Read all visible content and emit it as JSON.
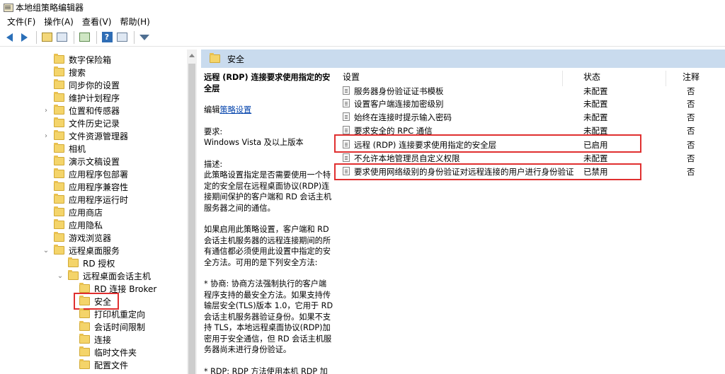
{
  "window": {
    "title": "本地组策略编辑器"
  },
  "menu": [
    "文件(F)",
    "操作(A)",
    "查看(V)",
    "帮助(H)"
  ],
  "toolbar": {
    "icons": [
      "back-icon",
      "forward-icon",
      "up-folder-icon",
      "show-hide-tree-icon",
      "export-icon",
      "help-icon",
      "properties-icon",
      "filter-icon"
    ],
    "help_glyph": "?"
  },
  "tree": {
    "items": [
      {
        "label": "数字保险箱",
        "indent": 0,
        "expander": ""
      },
      {
        "label": "搜索",
        "indent": 0,
        "expander": ""
      },
      {
        "label": "同步你的设置",
        "indent": 0,
        "expander": ""
      },
      {
        "label": "维护计划程序",
        "indent": 0,
        "expander": ""
      },
      {
        "label": "位置和传感器",
        "indent": 0,
        "expander": "›"
      },
      {
        "label": "文件历史记录",
        "indent": 0,
        "expander": ""
      },
      {
        "label": "文件资源管理器",
        "indent": 0,
        "expander": "›"
      },
      {
        "label": "相机",
        "indent": 0,
        "expander": ""
      },
      {
        "label": "演示文稿设置",
        "indent": 0,
        "expander": ""
      },
      {
        "label": "应用程序包部署",
        "indent": 0,
        "expander": ""
      },
      {
        "label": "应用程序兼容性",
        "indent": 0,
        "expander": ""
      },
      {
        "label": "应用程序运行时",
        "indent": 0,
        "expander": ""
      },
      {
        "label": "应用商店",
        "indent": 0,
        "expander": ""
      },
      {
        "label": "应用隐私",
        "indent": 0,
        "expander": ""
      },
      {
        "label": "游戏浏览器",
        "indent": 0,
        "expander": ""
      },
      {
        "label": "远程桌面服务",
        "indent": 0,
        "expander": "⌄"
      },
      {
        "label": "RD 授权",
        "indent": 1,
        "expander": ""
      },
      {
        "label": "远程桌面会话主机",
        "indent": 1,
        "expander": "⌄"
      },
      {
        "label": "RD 连接 Broker",
        "indent": 2,
        "expander": ""
      },
      {
        "label": "安全",
        "indent": 2,
        "expander": ""
      },
      {
        "label": "打印机重定向",
        "indent": 2,
        "expander": ""
      },
      {
        "label": "会话时间限制",
        "indent": 2,
        "expander": ""
      },
      {
        "label": "连接",
        "indent": 2,
        "expander": ""
      },
      {
        "label": "临时文件夹",
        "indent": 2,
        "expander": ""
      },
      {
        "label": "配置文件",
        "indent": 2,
        "expander": ""
      }
    ],
    "selected": "安全"
  },
  "right": {
    "header": "安全",
    "description": {
      "title": "远程 (RDP) 连接要求使用指定的安全层",
      "edit_prefix": "编辑",
      "edit_link": "策略设置",
      "req_label": "要求:",
      "req_value": "Windows Vista 及以上版本",
      "desc_label": "描述:",
      "desc_text": "此策略设置指定是否需要使用一个特定的安全层在远程桌面协议(RDP)连接期间保护的客户端和 RD 会话主机服务器之间的通信。",
      "para2": "如果启用此策略设置，客户端和 RD 会话主机服务器的远程连接期间的所有通信都必须使用此设置中指定的安全方法。可用的是下列安全方法:",
      "para3": "* 协商: 协商方法强制执行的客户端程序支持的最安全方法。如果支持传输层安全(TLS)版本 1.0，它用于 RD 会话主机服务器验证身份。如果不支持 TLS，本地远程桌面协议(RDP)加密用于安全通信，但 RD 会话主机服务器尚未进行身份验证。",
      "para4": "* RDP: RDP 方法使用本机 RDP 加密"
    },
    "columns": {
      "setting": "设置",
      "state": "状态",
      "note": "注释"
    },
    "rows": [
      {
        "name": "服务器身份验证证书模板",
        "state": "未配置",
        "note": "否"
      },
      {
        "name": "设置客户端连接加密级别",
        "state": "未配置",
        "note": "否"
      },
      {
        "name": "始终在连接时提示输入密码",
        "state": "未配置",
        "note": "否"
      },
      {
        "name": "要求安全的 RPC 通信",
        "state": "未配置",
        "note": "否"
      },
      {
        "name": "远程 (RDP) 连接要求使用指定的安全层",
        "state": "已启用",
        "note": "否"
      },
      {
        "name": "不允许本地管理员自定义权限",
        "state": "未配置",
        "note": "否"
      },
      {
        "name": "要求使用网络级别的身份验证对远程连接的用户进行身份验证",
        "state": "已禁用",
        "note": "否"
      }
    ]
  }
}
